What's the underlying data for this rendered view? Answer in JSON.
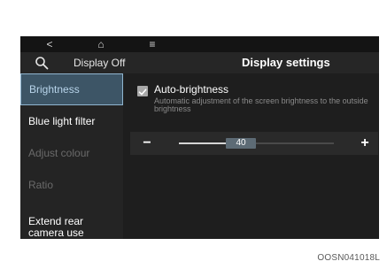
{
  "statusbar": {
    "back_icon": "<",
    "home_icon": "⌂",
    "menu_icon": "≡"
  },
  "header": {
    "search_icon": "search-icon",
    "display_off_label": "Display Off",
    "title": "Display settings"
  },
  "sidebar": {
    "items": [
      {
        "label": "Brightness",
        "state": "selected"
      },
      {
        "label": "Blue light filter",
        "state": "enabled"
      },
      {
        "label": "Adjust colour",
        "state": "disabled"
      },
      {
        "label": "Ratio",
        "state": "disabled"
      },
      {
        "label": "Extend rear camera use",
        "state": "enabled"
      }
    ]
  },
  "auto_brightness": {
    "label": "Auto-brightness",
    "checked": true,
    "description": "Automatic adjustment of the screen brightness to the outside brightness"
  },
  "brightness_slider": {
    "minus_label": "−",
    "plus_label": "+",
    "value": "40",
    "fraction": 0.4
  },
  "caption": "OOSN041018L",
  "colors": {
    "selected_bg": "#3d5566",
    "selected_border": "#8fb4cf",
    "screen_bg": "#1c1c1c",
    "disabled_text": "#6a6a6a"
  }
}
